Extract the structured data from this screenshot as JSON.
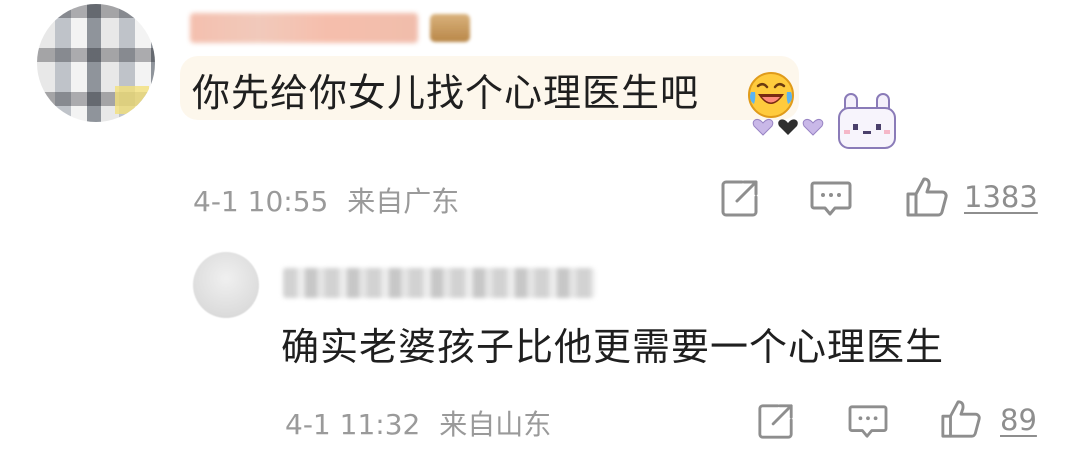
{
  "main_comment": {
    "text": "你先给你女儿找个心理医生吧",
    "timestamp": "4-1 10:55",
    "location": "来自广东",
    "like_count": "1383",
    "emoji": "laughing-crying-emoji",
    "sticker": "bunny-hearts-sticker"
  },
  "reply": {
    "text": "确实老婆孩子比他更需要一个心理医生",
    "timestamp": "4-1 11:32",
    "location": "来自山东",
    "like_count": "89"
  },
  "icons": {
    "share": "share-icon",
    "comment": "comment-icon",
    "like": "thumbs-up-icon"
  },
  "colors": {
    "bubble_bg": "#fdf7ec",
    "meta_text": "#9a9a9a",
    "body_text": "#1f1f1f"
  }
}
